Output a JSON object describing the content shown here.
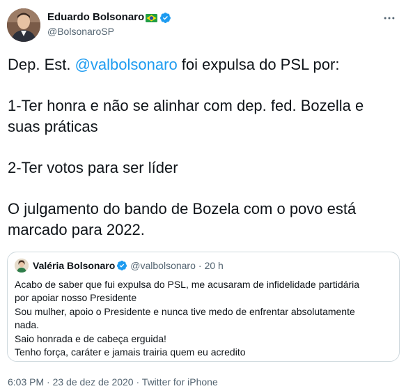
{
  "author": {
    "name": "Eduardo Bolsonaro",
    "flag": "Brazil flag",
    "handle": "@BolsonaroSP",
    "verified": true
  },
  "tweet": {
    "line1_prefix": "Dep. Est. ",
    "line1_mention": "@valbolsonaro",
    "line1_suffix": " foi expulsa do PSL por:",
    "reason1": "1-Ter honra e não se alinhar com dep. fed. Bozella e suas práticas",
    "reason2": "2-Ter votos para ser líder",
    "closing": "O julgamento do bando de Bozela com o povo está marcado para 2022."
  },
  "quote": {
    "name": "Valéria Bolsonaro",
    "handle": "@valbolsonaro",
    "separator": "·",
    "time": "20 h",
    "verified": true,
    "lines": [
      "Acabo de saber que fui expulsa do PSL, me acusaram de infidelidade partidária",
      "por apoiar nosso Presidente",
      "Sou mulher, apoio o Presidente e nunca tive medo de enfrentar absolutamente",
      "nada.",
      "Saio honrada e de cabeça erguida!",
      "Tenho força, caráter e jamais trairia quem eu acredito"
    ]
  },
  "meta": {
    "time": "6:03 PM",
    "sep1": "·",
    "date": "23 de dez de 2020",
    "sep2": "·",
    "source": "Twitter for iPhone"
  },
  "colors": {
    "accent": "#1d9bf0",
    "text": "#0f1419",
    "secondary": "#536471",
    "border": "#cfd9de"
  },
  "icons": {
    "verified": "verified-badge-icon",
    "more": "more-options-icon"
  }
}
